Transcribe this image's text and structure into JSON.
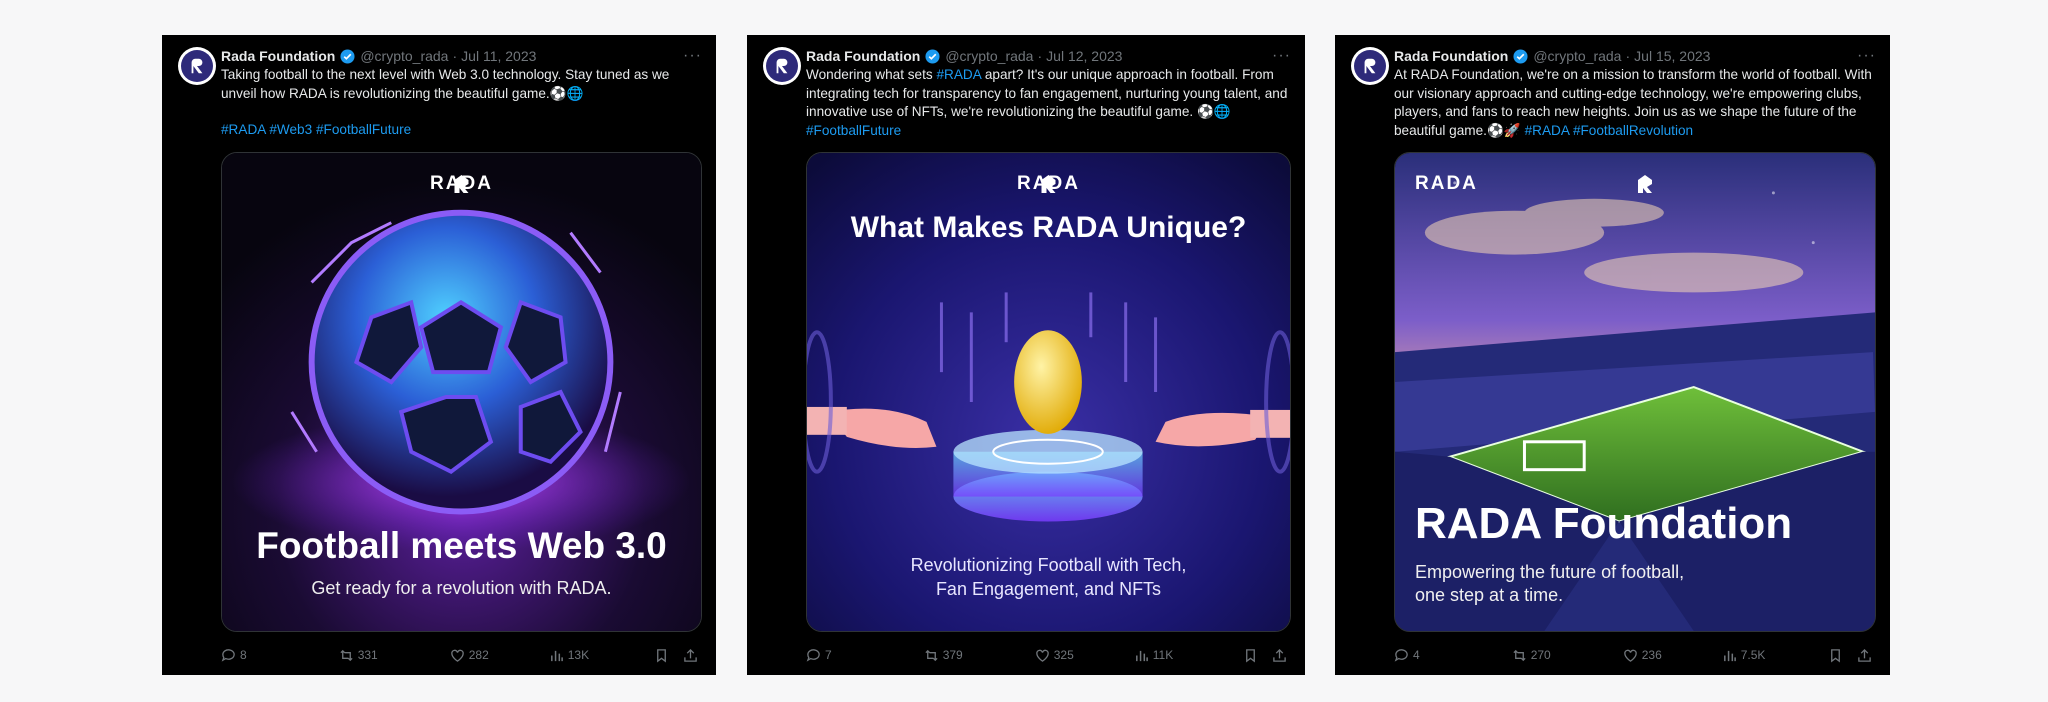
{
  "tweets": [
    {
      "name": "Rada Foundation",
      "handle": "@crypto_rada",
      "separator": "·",
      "date": "Jul 11, 2023",
      "more": "···",
      "text": "Taking football to the next level with Web 3.0 technology. Stay tuned as we unveil how RADA is revolutionizing the beautiful game.⚽🌐",
      "hashtags": "#RADA #Web3 #FootballFuture",
      "media": {
        "logo": "RADA",
        "headline": "Football meets Web 3.0",
        "subline": "Get ready for a revolution with RADA."
      },
      "stats": {
        "replies": "8",
        "reposts": "331",
        "likes": "282",
        "views": "13K"
      }
    },
    {
      "name": "Rada Foundation",
      "handle": "@crypto_rada",
      "separator": "·",
      "date": "Jul 12, 2023",
      "more": "···",
      "text_before": "Wondering what sets ",
      "text_tag": "#RADA",
      "text_after": " apart? It's our unique approach in football. From integrating tech for transparency to fan engagement, nurturing young talent, and innovative use of NFTs, we're revolutionizing the beautiful game. ⚽🌐 ",
      "text_tag2": "#FootballFuture",
      "media": {
        "logo": "RADA",
        "headline": "What Makes RADA Unique?",
        "subline1": "Revolutionizing Football with Tech,",
        "subline2": "Fan Engagement, and NFTs"
      },
      "stats": {
        "replies": "7",
        "reposts": "379",
        "likes": "325",
        "views": "11K"
      }
    },
    {
      "name": "Rada Foundation",
      "handle": "@crypto_rada",
      "separator": "·",
      "date": "Jul 15, 2023",
      "more": "···",
      "text": "At RADA Foundation, we're on a mission to transform the world of football. With our visionary approach and cutting-edge technology, we're empowering clubs, players, and fans to reach new heights. Join us as we shape the future of the beautiful game.⚽🚀 ",
      "text_tags": "#RADA #FootballRevolution",
      "media": {
        "logo": "RADA",
        "headline": "RADA Foundation",
        "subline1": "Empowering the future of football,",
        "subline2": "one step at a time."
      },
      "stats": {
        "replies": "4",
        "reposts": "270",
        "likes": "236",
        "views": "7.5K"
      }
    }
  ],
  "colors": {
    "accent": "#1d9bf0",
    "muted": "#71767b",
    "background": "#000000"
  }
}
